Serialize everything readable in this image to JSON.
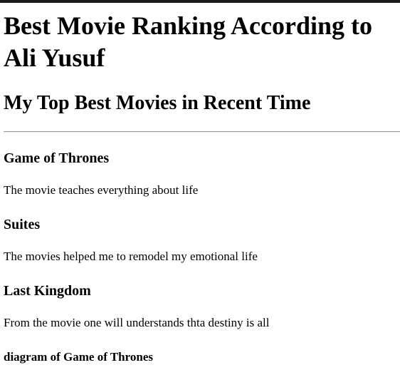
{
  "page": {
    "title_line1": "Best Movie Ranking According to",
    "title_line2": "Ali Yusuf",
    "subtitle": "My Top Best Movies in Recent Time"
  },
  "movies": [
    {
      "title": "Game of Thrones",
      "description": "The movie teaches everything about life"
    },
    {
      "title": "Suites",
      "description": "The movies helped me to remodel my emotional life"
    },
    {
      "title": "Last Kingdom",
      "description": "From the movie one will understands thta destiny is all"
    }
  ],
  "diagram": {
    "heading": "diagram of Game of Thrones"
  }
}
